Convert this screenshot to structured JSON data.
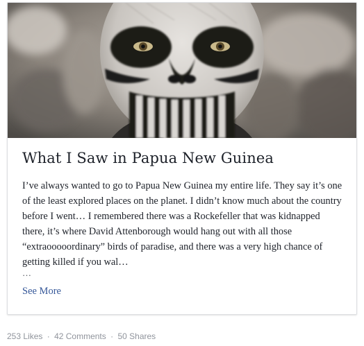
{
  "post": {
    "title": "What I Saw in Papua New Guinea",
    "excerpt": "I’ve always wanted to go to Papua New Guinea my entire life. They say it’s one of the least explored places on the planet. I didn’t know much about the country before I went… I remembered there was a Rockefeller that was kidnapped there, it’s where David Attenborough would hang out with all those “extraooooordinary” birds of paradise, and there was a very high chance of getting killed if you wal…",
    "ellipsis": "…",
    "see_more_label": "See More"
  },
  "stats": {
    "likes": "253 Likes",
    "comments": "42 Comments",
    "shares": "50 Shares",
    "separator": "·"
  },
  "colors": {
    "link": "#365899",
    "text": "#1d2129",
    "muted": "#90949c",
    "border": "#dddfe2"
  }
}
